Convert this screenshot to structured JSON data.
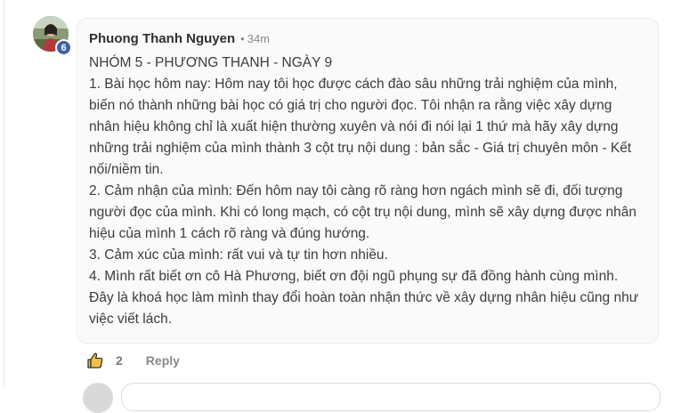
{
  "comment": {
    "author": "Phuong Thanh Nguyen",
    "separator": "•",
    "time": "34m",
    "level": "6",
    "lines": [
      "NHÓM 5 - PHƯƠNG THANH - NGÀY 9",
      "1. Bài học hôm nay: Hôm nay tôi học được cách đào sâu những trải nghiệm của mình,",
      "biến nó thành những bài học có giá trị cho người đọc. Tôi nhận ra rằng việc xây dựng",
      "nhân hiệu không chỉ là xuất hiện thường xuyên và nói đi nói lại 1 thứ mà hãy xây dựng",
      "những trải nghiệm của mình thành 3 cột trụ nội dung : bản sắc - Giá trị chuyên môn - Kết",
      "nối/niềm tin.",
      "2. Cảm nhận của mình: Đến hôm nay tôi càng rõ ràng hơn ngách mình sẽ đi, đối tượng",
      "người đọc của mình. Khi có long mạch, có cột trụ nội dung, mình sẽ xây dựng được nhân",
      "hiệu của mình 1 cách rõ ràng và đúng hướng.",
      "3. Cảm xúc của mình: rất vui và tự tin hơn nhiều.",
      "4. Mình rất biết ơn cô Hà Phương, biết ơn đội ngũ phụng sự đã đồng hành cùng mình.",
      "Đây là khoá học làm mình thay đổi hoàn toàn nhận thức về xây dựng nhân hiệu cũng như",
      "việc viết lách."
    ]
  },
  "actions": {
    "like_icon": "thumbs-up-icon",
    "like_count": "2",
    "reply_label": "Reply"
  },
  "colors": {
    "badge": "#3f5fa8",
    "bubble": "#fafafa",
    "like_icon_fill": "#f3c043"
  }
}
